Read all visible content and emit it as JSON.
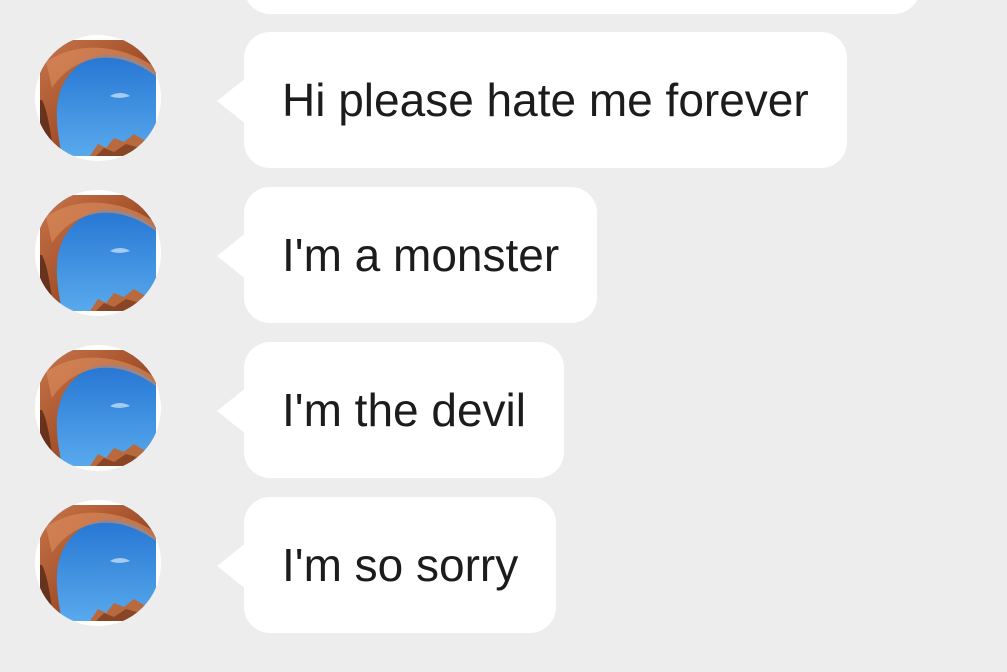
{
  "conversation": {
    "messages": [
      {
        "text": "Hi please hate me forever",
        "avatar_icon": "desert-arch-photo-icon"
      },
      {
        "text": "I'm a monster",
        "avatar_icon": "desert-arch-photo-icon"
      },
      {
        "text": "I'm the devil",
        "avatar_icon": "desert-arch-photo-icon"
      },
      {
        "text": "I'm so sorry",
        "avatar_icon": "desert-arch-photo-icon"
      }
    ]
  },
  "colors": {
    "background": "#ededed",
    "bubble": "#ffffff",
    "text": "#1c1c1c",
    "sky": "#2f7fd6",
    "rock": "#a8552c"
  }
}
